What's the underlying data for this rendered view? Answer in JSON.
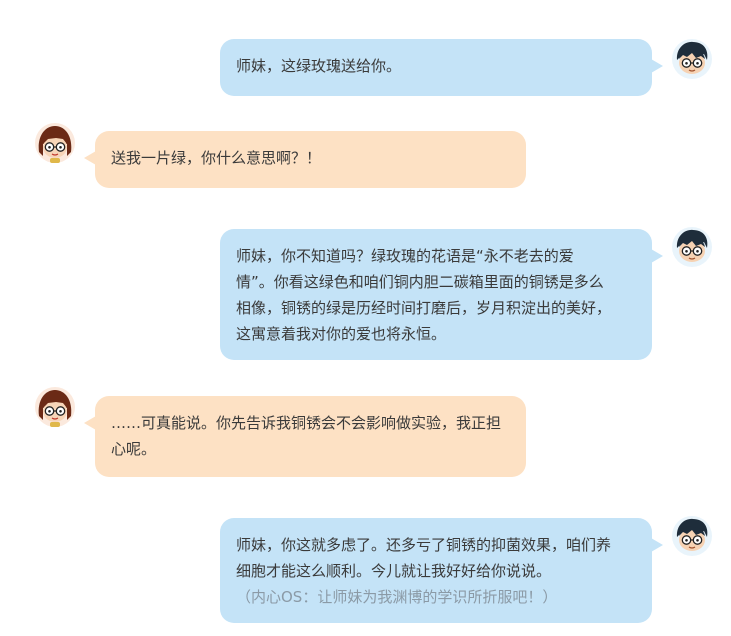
{
  "messages": [
    {
      "side": "right",
      "speaker": "senior-brother",
      "lines": [
        "师妹，这绿玫瑰送给你。"
      ]
    },
    {
      "side": "left",
      "speaker": "junior-sister",
      "lines": [
        "送我一片绿，你什么意思啊？！"
      ]
    },
    {
      "side": "right",
      "speaker": "senior-brother",
      "lines": [
        "师妹，你不知道吗？绿玫瑰的花语是“永不老去的爱",
        "情”。你看这绿色和咱们铜内胆二碳箱里面的铜锈是多么",
        "相像，铜锈的绿是历经时间打磨后，岁月积淀出的美好，",
        "这寓意着我对你的爱也将永恒。"
      ]
    },
    {
      "side": "left",
      "speaker": "junior-sister",
      "lines": [
        "……可真能说。你先告诉我铜锈会不会影响做实验，我正担",
        "心呢。"
      ]
    },
    {
      "side": "right",
      "speaker": "senior-brother",
      "lines": [
        "师妹，你这就多虑了。还多亏了铜锈的抑菌效果，咱们养",
        "细胞才能这么顺利。今儿就让我好好给你说说。"
      ],
      "aside": "（内心OS：让师妹为我渊博的学识所折服吧！）"
    }
  ],
  "colors": {
    "right_bubble": "#c4e3f7",
    "left_bubble": "#fde1c4",
    "text": "#3a3a3a",
    "aside_text": "#8b9aa6"
  },
  "icons": {
    "senior_brother_avatar": "boy-with-glasses-avatar-icon",
    "junior_sister_avatar": "girl-with-glasses-avatar-icon"
  }
}
